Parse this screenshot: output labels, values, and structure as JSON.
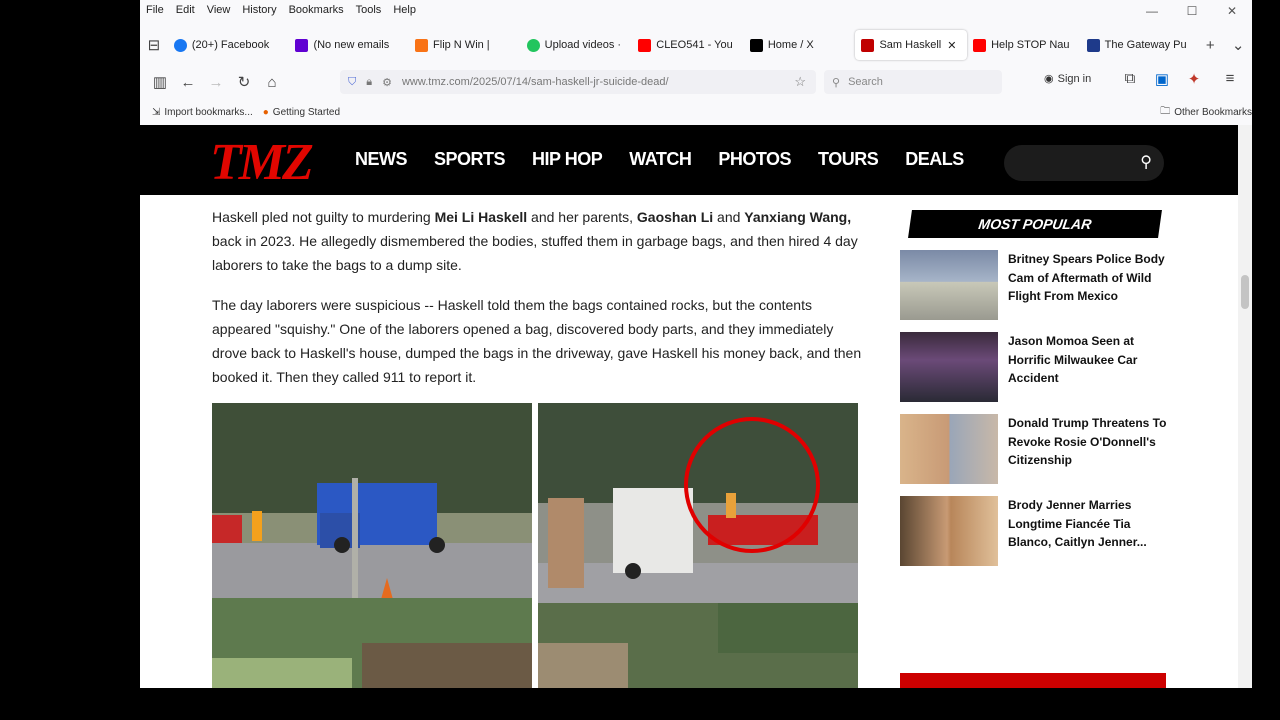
{
  "menu": [
    "File",
    "Edit",
    "View",
    "History",
    "Bookmarks",
    "Tools",
    "Help"
  ],
  "window_controls": [
    "—",
    "☐",
    "✕"
  ],
  "tabs": [
    {
      "label": "(20+) Facebook",
      "color": "#1877f2"
    },
    {
      "label": "(No new emails",
      "color": "#6001d2"
    },
    {
      "label": "Flip N Win |",
      "color": "#f97316"
    },
    {
      "label": "Upload videos ·",
      "color": "#22c55e"
    },
    {
      "label": "CLEO541 - You",
      "color": "#ff0000"
    },
    {
      "label": "Home / X",
      "color": "#000000"
    },
    {
      "label": "Sam Haskell",
      "color": "#c00000"
    },
    {
      "label": "Help STOP Nau",
      "color": "#ff0000"
    },
    {
      "label": "The Gateway Pu",
      "color": "#1e3a8a"
    }
  ],
  "url": "www.tmz.com/2025/07/14/sam-haskell-jr-suicide-dead/",
  "search_placeholder": "Search",
  "signin": "Sign in",
  "bookmarks": {
    "import": "Import bookmarks...",
    "getting_started": "Getting Started",
    "other": "Other Bookmarks"
  },
  "tmz": {
    "logo": "TMZ",
    "nav": [
      "NEWS",
      "SPORTS",
      "HIP HOP",
      "WATCH",
      "PHOTOS",
      "TOURS",
      "DEALS"
    ]
  },
  "article": {
    "p1_a": "Haskell pled not guilty to murdering ",
    "p1_b": "Mei Li Haskell",
    "p1_c": " and her parents, ",
    "p1_d": "Gaoshan Li",
    "p1_e": " and ",
    "p1_f": "Yanxiang Wang,",
    "p1_g": " back in 2023. He allegedly dismembered the bodies, stuffed them in garbage bags, and then hired 4 day laborers to take the bags to a dump site.",
    "p2": "The day laborers were suspicious -- Haskell told them the bags contained rocks, but the contents appeared \"squishy.\" One of the laborers opened a bag, discovered body parts, and they immediately drove back to Haskell's house, dumped the bags in the driveway, gave Haskell his money back, and then booked it. Then they called 911 to report it."
  },
  "most_popular": {
    "title": "MOST POPULAR",
    "items": [
      "Britney Spears Police Body Cam of Aftermath of Wild Flight From Mexico",
      "Jason Momoa Seen at Horrific Milwaukee Car Accident",
      "Donald Trump Threatens To Revoke Rosie O'Donnell's Citizenship",
      "Brody Jenner Marries Longtime Fiancée Tia Blanco, Caitlyn Jenner..."
    ]
  }
}
